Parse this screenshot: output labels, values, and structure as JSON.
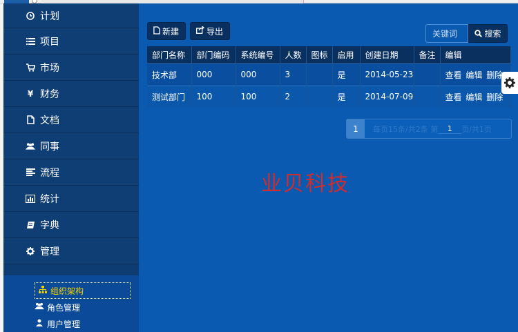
{
  "sidebar": {
    "items": [
      {
        "label": "计划",
        "icon": "clock-icon"
      },
      {
        "label": "项目",
        "icon": "list-icon"
      },
      {
        "label": "市场",
        "icon": "cart-icon"
      },
      {
        "label": "财务",
        "icon": "yen-icon"
      },
      {
        "label": "文档",
        "icon": "file-icon"
      },
      {
        "label": "同事",
        "icon": "users-icon"
      },
      {
        "label": "流程",
        "icon": "align-icon"
      },
      {
        "label": "统计",
        "icon": "bar-chart-icon"
      },
      {
        "label": "字典",
        "icon": "book-icon"
      },
      {
        "label": "管理",
        "icon": "cog-icon"
      }
    ],
    "sub_items": [
      {
        "label": "组织架构",
        "icon": "sitemap-icon",
        "active": true
      },
      {
        "label": "角色管理",
        "icon": "users-icon",
        "active": false
      },
      {
        "label": "用户管理",
        "icon": "user-icon",
        "active": false
      }
    ]
  },
  "toolbar": {
    "new_label": "新建",
    "export_label": "导出",
    "search_placeholder": "关键词",
    "search_label": "搜索"
  },
  "table": {
    "columns": [
      "部门名称",
      "部门编码",
      "系统编号",
      "人数",
      "图标",
      "启用",
      "创建日期",
      "备注",
      "编辑"
    ],
    "rows": [
      {
        "name": "技术部",
        "code": "000",
        "sys_no": "000",
        "count": "3",
        "icon": "",
        "enabled": "是",
        "created": "2014-05-23",
        "note": "",
        "actions": [
          "查看",
          "编辑",
          "删除"
        ]
      },
      {
        "name": "测试部门",
        "code": "100",
        "sys_no": "100",
        "count": "2",
        "icon": "",
        "enabled": "是",
        "created": "2014-07-09",
        "note": "",
        "actions": [
          "查看",
          "编辑",
          "删除"
        ]
      }
    ]
  },
  "pager": {
    "current_page": "1",
    "info_prefix": "每页15条/共2条 第",
    "page_value": "1",
    "info_suffix": "页/共1页"
  },
  "watermark": "业贝科技",
  "colors": {
    "sidebar_bg": "#0d3c73",
    "main_bg": "#0b5ab2",
    "header_bg": "#0a3060",
    "active_sub": "#f2d200",
    "watermark": "#d02c2c"
  }
}
